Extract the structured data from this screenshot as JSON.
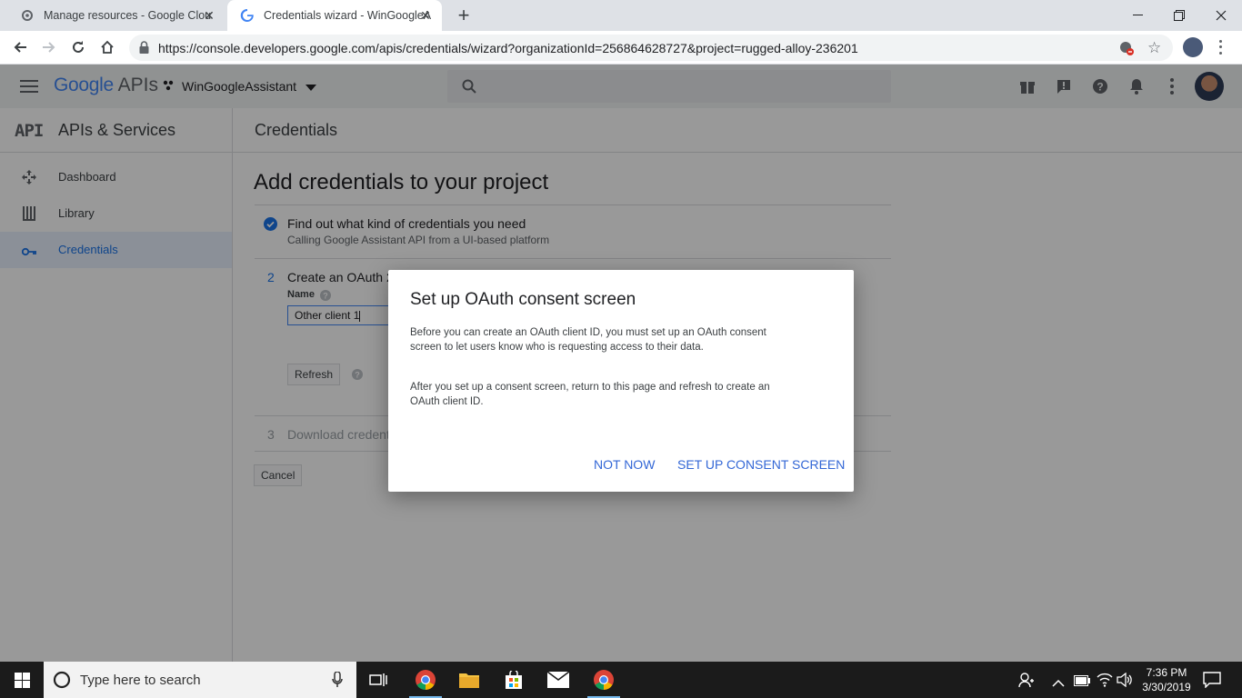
{
  "browser": {
    "tabs": [
      {
        "title": "Manage resources - Google Clou"
      },
      {
        "title": "Credentials wizard - WinGoogleA"
      }
    ],
    "new_tab_symbol": "+",
    "url": "https://console.developers.google.com/apis/credentials/wizard?organizationId=256864628727&project=rugged-alloy-236201"
  },
  "header": {
    "logo_google": "Google",
    "logo_apis": "APIs",
    "project_name": "WinGoogleAssistant"
  },
  "sidebar": {
    "api_badge": "API",
    "title": "APIs & Services",
    "items": [
      {
        "label": "Dashboard",
        "icon": "dashboard-icon"
      },
      {
        "label": "Library",
        "icon": "library-icon"
      },
      {
        "label": "Credentials",
        "icon": "key-icon"
      }
    ]
  },
  "main": {
    "page_header": "Credentials",
    "title": "Add credentials to your project",
    "step1": {
      "title": "Find out what kind of credentials you need",
      "subtitle": "Calling Google Assistant API from a UI-based platform"
    },
    "step2": {
      "number": "2",
      "title": "Create an OAuth 2",
      "name_label": "Name",
      "name_value": "Other client 1",
      "refresh_label": "Refresh"
    },
    "step3": {
      "number": "3",
      "title": "Download credent"
    },
    "cancel_label": "Cancel"
  },
  "dialog": {
    "title": "Set up OAuth consent screen",
    "para1": "Before you can create an OAuth client ID, you must set up an OAuth consent screen to let users know who is requesting access to their data.",
    "para2": "After you set up a consent screen, return to this page and refresh to create an OAuth client ID.",
    "not_now": "NOT NOW",
    "setup": "SET UP CONSENT SCREEN"
  },
  "taskbar": {
    "search_placeholder": "Type here to search",
    "time": "7:36 PM",
    "date": "3/30/2019"
  },
  "colors": {
    "accent": "#1a73e8",
    "dialog_button": "#3367d6",
    "sidebar_active_bg": "#e8f0fe"
  }
}
